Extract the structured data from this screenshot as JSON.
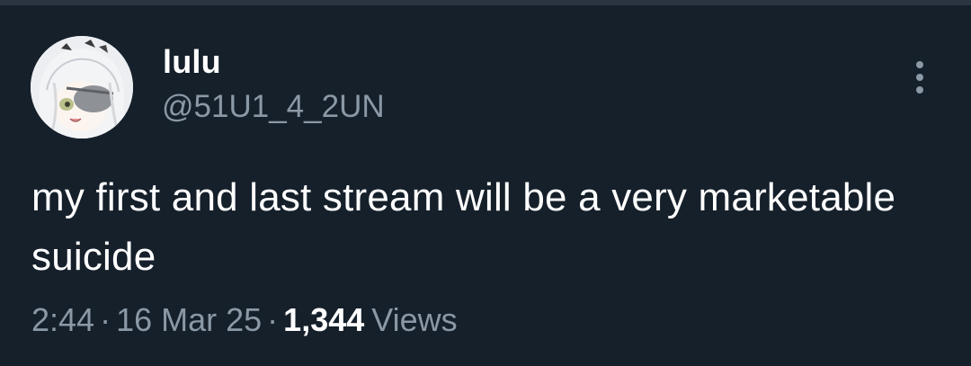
{
  "tweet": {
    "author": {
      "display_name": "lulu",
      "handle": "@51U1_4_2UN"
    },
    "text": "my first and last stream will be a very marketable suicide",
    "time": "2:44",
    "date": "16 Mar 25",
    "separator": "·",
    "views_count": "1,344",
    "views_label": "Views"
  },
  "icons": {
    "more": "more-vertical-icon"
  },
  "colors": {
    "background": "#15202b",
    "primary_text": "#ffffff",
    "secondary_text": "#8b98a5"
  }
}
